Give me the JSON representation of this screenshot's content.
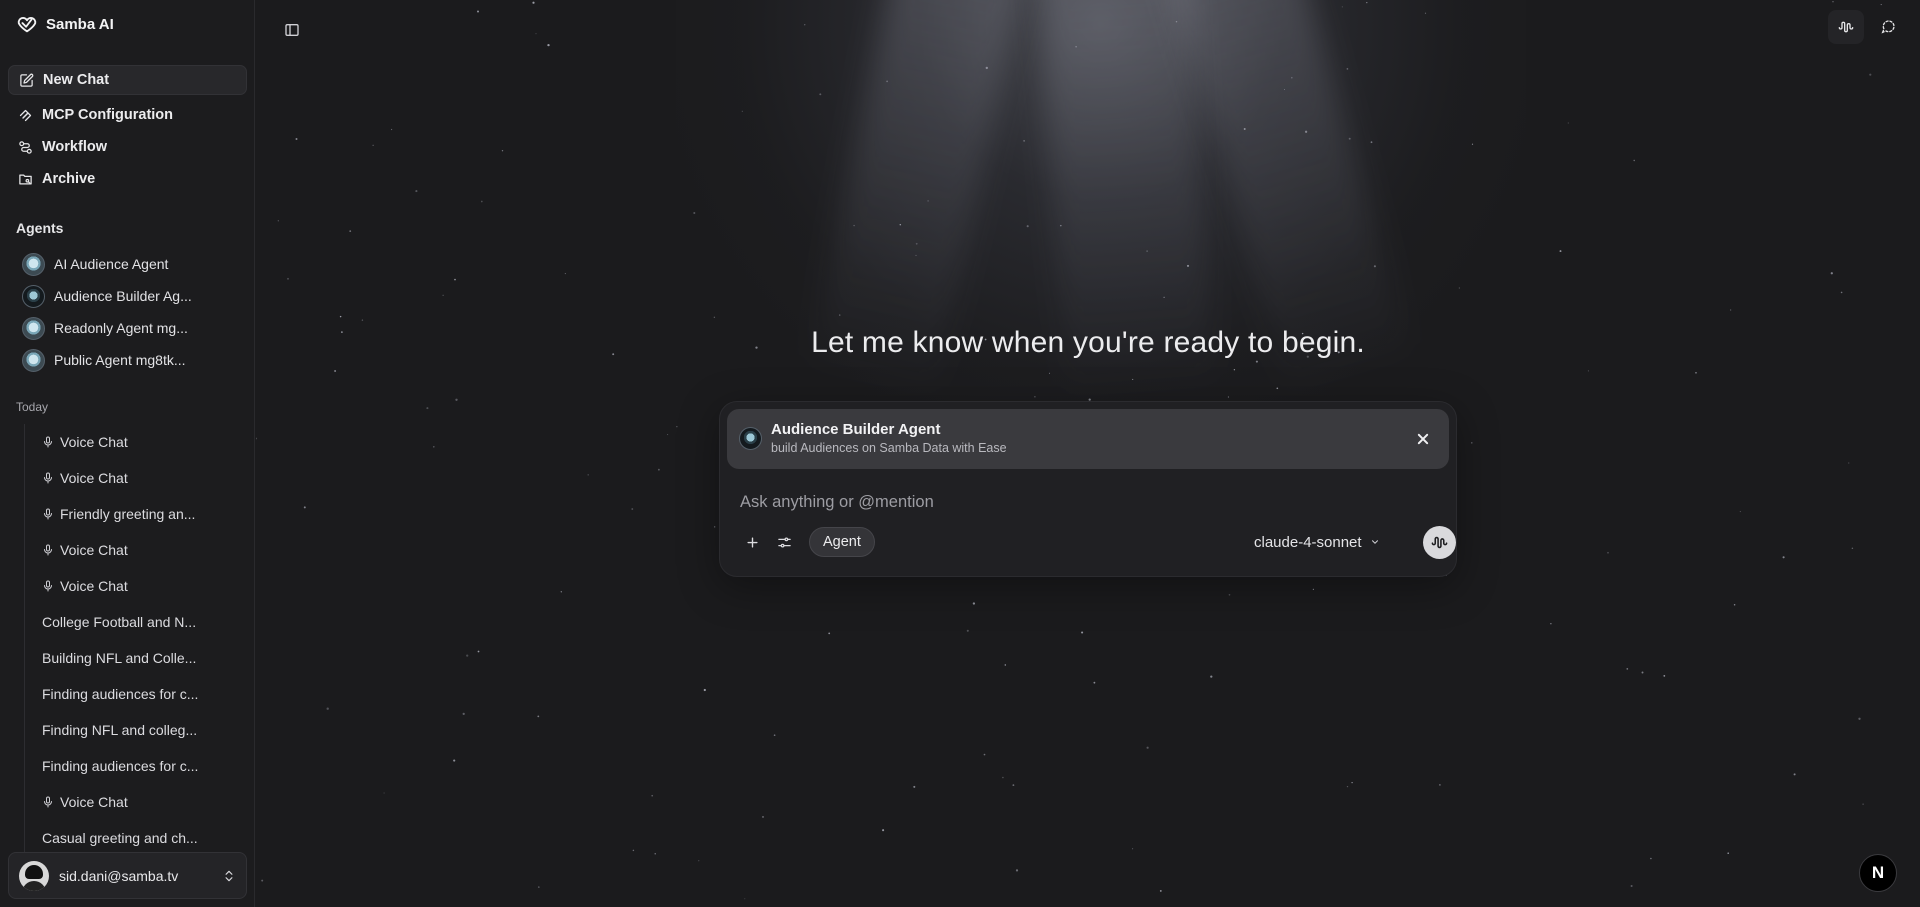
{
  "app": {
    "name": "Samba AI"
  },
  "nav": {
    "new_chat": "New Chat",
    "mcp": "MCP Configuration",
    "workflow": "Workflow",
    "archive": "Archive"
  },
  "agents": {
    "label": "Agents",
    "items": [
      {
        "label": "AI Audience Agent"
      },
      {
        "label": "Audience Builder Ag..."
      },
      {
        "label": "Readonly Agent mg..."
      },
      {
        "label": "Public Agent mg8tk..."
      }
    ]
  },
  "history": {
    "label": "Today",
    "items": [
      {
        "label": "Voice Chat",
        "icon": "mic-icon"
      },
      {
        "label": "Voice Chat",
        "icon": "mic-icon"
      },
      {
        "label": "Friendly greeting an...",
        "icon": "mic-icon"
      },
      {
        "label": "Voice Chat",
        "icon": "mic-icon"
      },
      {
        "label": "Voice Chat",
        "icon": "mic-icon"
      },
      {
        "label": "College Football and N..."
      },
      {
        "label": "Building NFL and Colle..."
      },
      {
        "label": "Finding audiences for c..."
      },
      {
        "label": "Finding NFL and colleg..."
      },
      {
        "label": "Finding audiences for c..."
      },
      {
        "label": "Voice Chat",
        "icon": "mic-icon"
      },
      {
        "label": "Casual greeting and ch..."
      }
    ]
  },
  "user": {
    "email": "sid.dani@samba.tv"
  },
  "main": {
    "headline": "Let me know when you're ready to begin.",
    "selected_agent": {
      "name": "Audience Builder Agent",
      "description": "build Audiences on Samba Data with Ease"
    },
    "input_placeholder": "Ask anything or @mention",
    "mode_chip": "Agent",
    "model": "claude-4-sonnet"
  },
  "badge": {
    "letter": "N"
  },
  "colors": {
    "background": "#1b1b1d",
    "sidebar": "#1c1c1e",
    "banner": "#3a3a3e"
  }
}
